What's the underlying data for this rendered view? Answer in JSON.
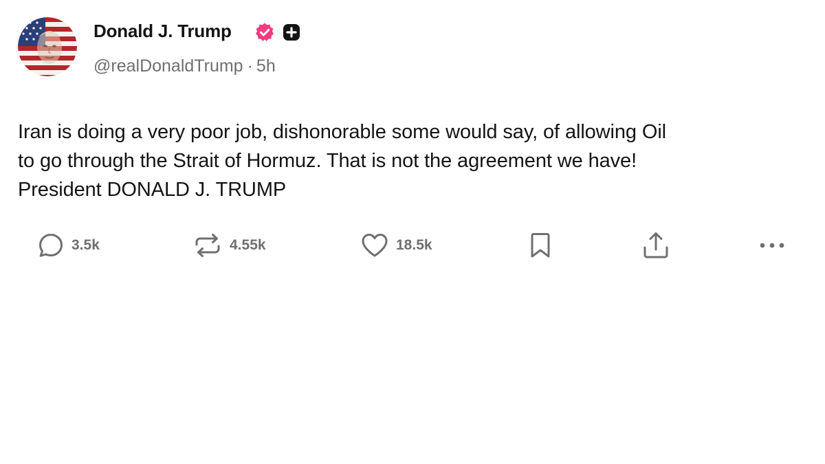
{
  "post": {
    "author": {
      "name": "Donald J. Trump",
      "handle": "@realDonaldTrump",
      "separator": "·",
      "time": "5h",
      "avatar_icon": "flag-portrait-avatar",
      "verified_icon": "verified-check-badge-icon",
      "verified_color": "#ee3d80",
      "badge_icon": "plus-badge-icon"
    },
    "text_lines": [
      "Iran is doing a very poor job, dishonorable some would say, of allowing Oil",
      "to go through the Strait of Hormuz. That is not the agreement we have!",
      "President DONALD J. TRUMP"
    ],
    "actions": {
      "reply": {
        "icon": "reply-bubble-icon",
        "count": "3.5k"
      },
      "repost": {
        "icon": "repost-arrows-icon",
        "count": "4.55k"
      },
      "like": {
        "icon": "heart-icon",
        "count": "18.5k"
      },
      "bookmark": {
        "icon": "bookmark-icon"
      },
      "share": {
        "icon": "share-upload-icon"
      },
      "more": {
        "icon": "more-dots-icon"
      }
    }
  },
  "colors": {
    "text": "#141414",
    "muted": "#6f6f6f",
    "background": "#ffffff",
    "verified": "#ee3d80"
  }
}
